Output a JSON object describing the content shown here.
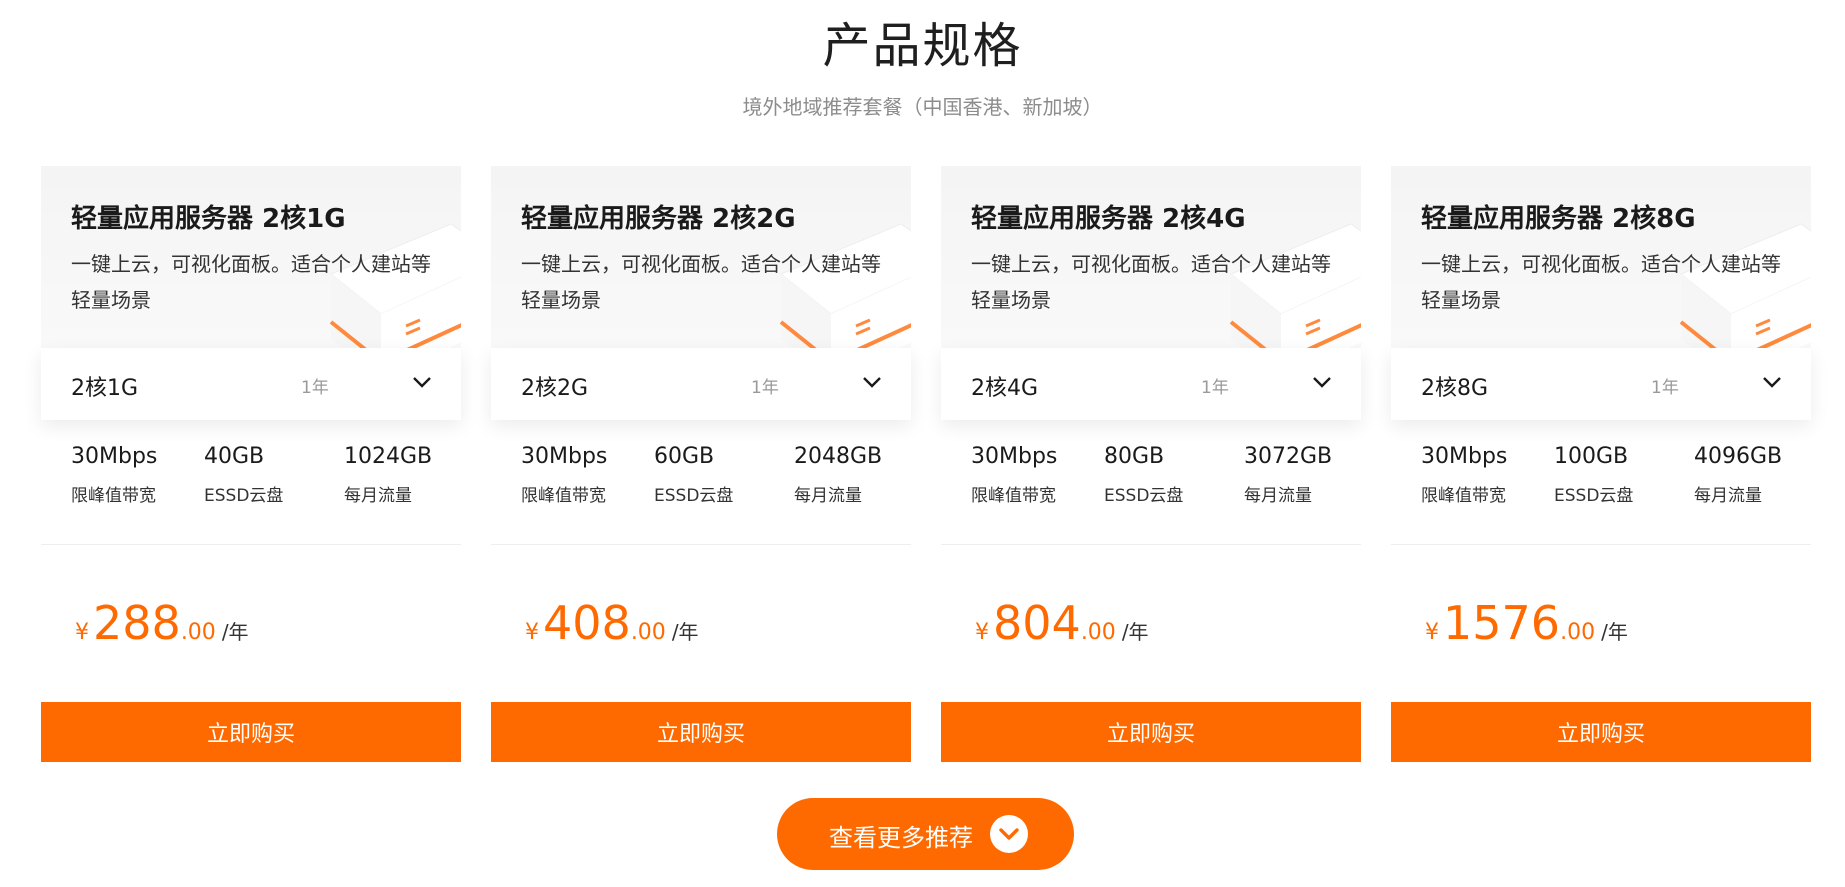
{
  "header": {
    "title": "产品规格",
    "subtitle": "境外地域推荐套餐（中国香港、新加坡）"
  },
  "cards": [
    {
      "title": "轻量应用服务器 2核1G",
      "desc": "一键上云，可视化面板。适合个人建站等轻量场景",
      "config": "2核1G",
      "term": "1年",
      "bandwidth": "30Mbps",
      "bandwidth_label": "限峰值带宽",
      "disk": "40GB",
      "disk_label": "ESSD云盘",
      "traffic": "1024GB",
      "traffic_label": "每月流量",
      "currency": "¥",
      "price_int": "288",
      "price_dec": ".00",
      "price_unit": "/年",
      "buy_label": "立即购买"
    },
    {
      "title": "轻量应用服务器 2核2G",
      "desc": "一键上云，可视化面板。适合个人建站等轻量场景",
      "config": "2核2G",
      "term": "1年",
      "bandwidth": "30Mbps",
      "bandwidth_label": "限峰值带宽",
      "disk": "60GB",
      "disk_label": "ESSD云盘",
      "traffic": "2048GB",
      "traffic_label": "每月流量",
      "currency": "¥",
      "price_int": "408",
      "price_dec": ".00",
      "price_unit": "/年",
      "buy_label": "立即购买"
    },
    {
      "title": "轻量应用服务器 2核4G",
      "desc": "一键上云，可视化面板。适合个人建站等轻量场景",
      "config": "2核4G",
      "term": "1年",
      "bandwidth": "30Mbps",
      "bandwidth_label": "限峰值带宽",
      "disk": "80GB",
      "disk_label": "ESSD云盘",
      "traffic": "3072GB",
      "traffic_label": "每月流量",
      "currency": "¥",
      "price_int": "804",
      "price_dec": ".00",
      "price_unit": "/年",
      "buy_label": "立即购买"
    },
    {
      "title": "轻量应用服务器 2核8G",
      "desc": "一键上云，可视化面板。适合个人建站等轻量场景",
      "config": "2核8G",
      "term": "1年",
      "bandwidth": "30Mbps",
      "bandwidth_label": "限峰值带宽",
      "disk": "100GB",
      "disk_label": "ESSD云盘",
      "traffic": "4096GB",
      "traffic_label": "每月流量",
      "currency": "¥",
      "price_int": "1576",
      "price_dec": ".00",
      "price_unit": "/年",
      "buy_label": "立即购买"
    }
  ],
  "more": {
    "label": "查看更多推荐",
    "icon": "chevron-down-icon"
  },
  "colors": {
    "accent": "#ff6a00",
    "card_head_bg": "#f4f4f4"
  }
}
